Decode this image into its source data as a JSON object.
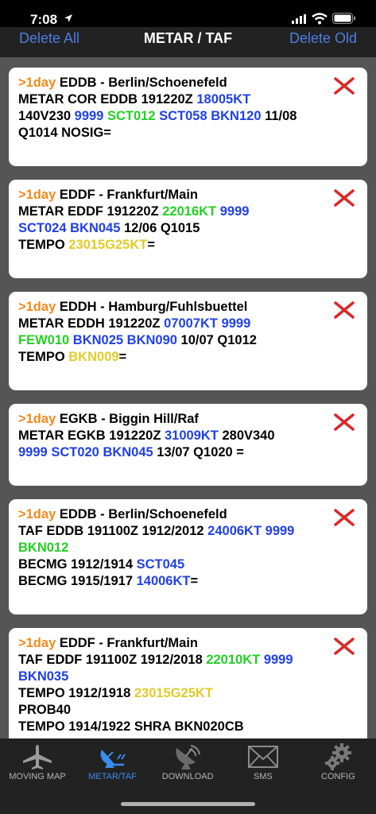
{
  "status": {
    "time": "7:08"
  },
  "nav": {
    "delete_all": "Delete All",
    "title": "METAR / TAF",
    "delete_old": "Delete Old"
  },
  "colors": {
    "age": "#f08a1c",
    "blue": "#2040e8",
    "green": "#22d022",
    "yellow": "#e0cc28",
    "delete": "#d62a2a",
    "tab_active": "#3a8ef0"
  },
  "reports": [
    {
      "age": ">1day",
      "station": " EDDB - Berlin/Schoenefeld",
      "height": 124,
      "lines": [
        [
          {
            "t": "METAR COR EDDB 191220Z "
          },
          {
            "t": "18005KT",
            "c": "blue"
          }
        ],
        [
          {
            "t": "140V230 "
          },
          {
            "t": "9999",
            "c": "blue"
          },
          {
            "t": " "
          },
          {
            "t": "SCT012",
            "c": "green"
          },
          {
            "t": " "
          },
          {
            "t": "SCT058",
            "c": "blue"
          },
          {
            "t": " "
          },
          {
            "t": "BKN120",
            "c": "blue"
          },
          {
            "t": " 11/08"
          }
        ],
        [
          {
            "t": "Q1014 NOSIG="
          }
        ]
      ]
    },
    {
      "age": ">1day",
      "station": " EDDF - Frankfurt/Main",
      "height": 124,
      "lines": [
        [
          {
            "t": "METAR EDDF 191220Z "
          },
          {
            "t": "22016KT",
            "c": "green"
          },
          {
            "t": " "
          },
          {
            "t": "9999",
            "c": "blue"
          }
        ],
        [
          {
            "t": "SCT024",
            "c": "blue"
          },
          {
            "t": " "
          },
          {
            "t": "BKN045",
            "c": "blue"
          },
          {
            "t": " 12/06 Q1015"
          }
        ],
        [
          {
            "t": "TEMPO "
          },
          {
            "t": "23015G25KT",
            "c": "yellow"
          },
          {
            "t": "="
          }
        ]
      ]
    },
    {
      "age": ">1day",
      "station": " EDDH - Hamburg/Fuhlsbuettel",
      "height": 124,
      "lines": [
        [
          {
            "t": "METAR EDDH 191220Z "
          },
          {
            "t": "07007KT",
            "c": "blue"
          },
          {
            "t": " "
          },
          {
            "t": "9999",
            "c": "blue"
          }
        ],
        [
          {
            "t": "FEW010",
            "c": "green"
          },
          {
            "t": " "
          },
          {
            "t": "BKN025",
            "c": "blue"
          },
          {
            "t": " "
          },
          {
            "t": "BKN090",
            "c": "blue"
          },
          {
            "t": " 10/07 Q1012"
          }
        ],
        [
          {
            "t": "TEMPO "
          },
          {
            "t": "BKN009",
            "c": "yellow"
          },
          {
            "t": "="
          }
        ]
      ]
    },
    {
      "age": ">1day",
      "station": " EGKB - Biggin Hill/Raf",
      "height": 103,
      "lines": [
        [
          {
            "t": "METAR EGKB 191220Z "
          },
          {
            "t": "31009KT",
            "c": "blue"
          },
          {
            "t": " 280V340"
          }
        ],
        [
          {
            "t": "9999",
            "c": "blue"
          },
          {
            "t": " "
          },
          {
            "t": "SCT020",
            "c": "blue"
          },
          {
            "t": " "
          },
          {
            "t": "BKN045",
            "c": "blue"
          },
          {
            "t": " 13/07 Q1020 ="
          }
        ]
      ]
    },
    {
      "age": ">1day",
      "station": " EDDB - Berlin/Schoenefeld",
      "height": 145,
      "lines": [
        [
          {
            "t": "TAF EDDB 191100Z 1912/2012 "
          },
          {
            "t": "24006KT",
            "c": "blue"
          },
          {
            "t": " "
          },
          {
            "t": "9999",
            "c": "blue"
          }
        ],
        [
          {
            "t": "BKN012",
            "c": "green"
          }
        ],
        [
          {
            "t": "BECMG 1912/1914 "
          },
          {
            "t": "SCT045",
            "c": "blue"
          }
        ],
        [
          {
            "t": "BECMG 1915/1917 "
          },
          {
            "t": "14006KT",
            "c": "blue"
          },
          {
            "t": "="
          }
        ]
      ]
    },
    {
      "age": ">1day",
      "station": " EDDF - Frankfurt/Main",
      "height": 200,
      "lines": [
        [
          {
            "t": "TAF EDDF 191100Z 1912/2018 "
          },
          {
            "t": "22010KT",
            "c": "green"
          },
          {
            "t": " "
          },
          {
            "t": "9999",
            "c": "blue"
          }
        ],
        [
          {
            "t": "BKN035",
            "c": "blue"
          }
        ],
        [
          {
            "t": "TEMPO 1912/1918 "
          },
          {
            "t": "23015G25KT",
            "c": "yellow"
          }
        ],
        [
          {
            "t": "PROB40"
          }
        ],
        [
          {
            "t": "TEMPO 1914/1922 SHRA BKN020CB"
          }
        ]
      ]
    }
  ],
  "tabs": [
    {
      "label": "MOVING MAP",
      "icon": "airplane-icon",
      "active": false
    },
    {
      "label": "METAR/TAF",
      "icon": "satellite-dish-icon",
      "active": true
    },
    {
      "label": "DOWNLOAD",
      "icon": "antenna-download-icon",
      "active": false
    },
    {
      "label": "SMS",
      "icon": "envelope-icon",
      "active": false
    },
    {
      "label": "CONFIG",
      "icon": "gear-icon",
      "active": false
    }
  ]
}
